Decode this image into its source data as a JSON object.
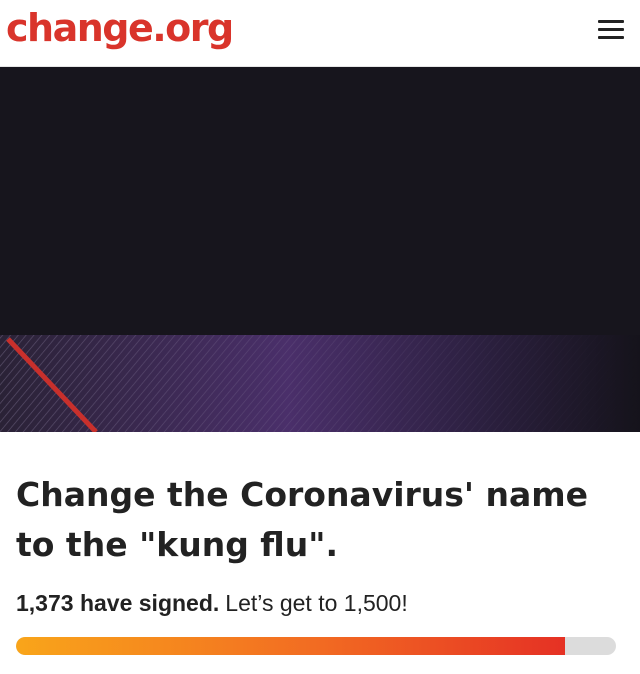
{
  "header": {
    "logo_text": "change.org",
    "menu_icon": "hamburger-menu-icon",
    "brand_color": "#d9342b"
  },
  "hero": {
    "description": ""
  },
  "petition": {
    "title": "Change the Coronavirus' name to the \"kung flu\".",
    "signed_count_text": "1,373 have signed.",
    "goal_text": "Let’s get to 1,500!",
    "signatures": 1373,
    "goal": 1500
  },
  "progress": {
    "fraction": 0.915,
    "colors": {
      "start": "#f9a51a",
      "end": "#e53124",
      "track": "#dcdcdc"
    }
  }
}
